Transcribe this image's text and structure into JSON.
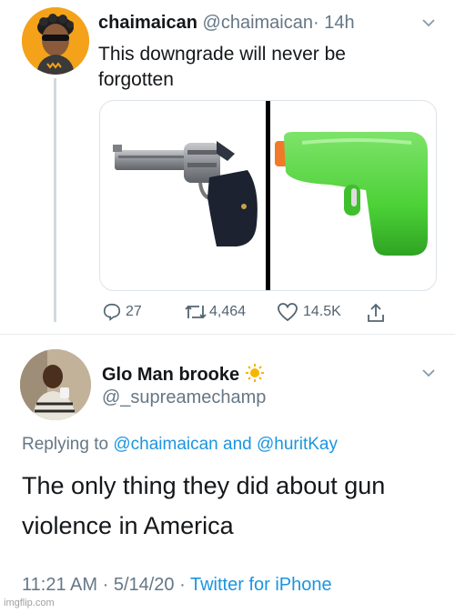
{
  "tweet": {
    "display_name": "chaimaican",
    "handle": "@chaimaican",
    "dot": "·",
    "time": "14h",
    "text": "This downgrade will never be forgotten",
    "media": {
      "left": "revolver pistol emoji",
      "right": "green water gun emoji"
    },
    "actions": {
      "replies": "27",
      "retweets": "4,464",
      "likes": "14.5K"
    }
  },
  "reply": {
    "display_name": "Glo Man brooke",
    "name_emoji": "sun-icon",
    "handle": "@_supreamechamp",
    "replying_prefix": "Replying to",
    "replying_user1": "@chaimaican",
    "replying_and": "and",
    "replying_user2": "@huritKay",
    "text": "The only thing they did about gun violence in America",
    "time": "11:21 AM",
    "date": "5/14/20",
    "dot": "·",
    "source": "Twitter for iPhone"
  },
  "watermark": "imgflip.com",
  "colors": {
    "link": "#1b95e0",
    "secondary_text": "#657786",
    "primary_text": "#14171a",
    "water_gun_green": "#4cd137",
    "avatar_bg": "#f4a21a"
  }
}
